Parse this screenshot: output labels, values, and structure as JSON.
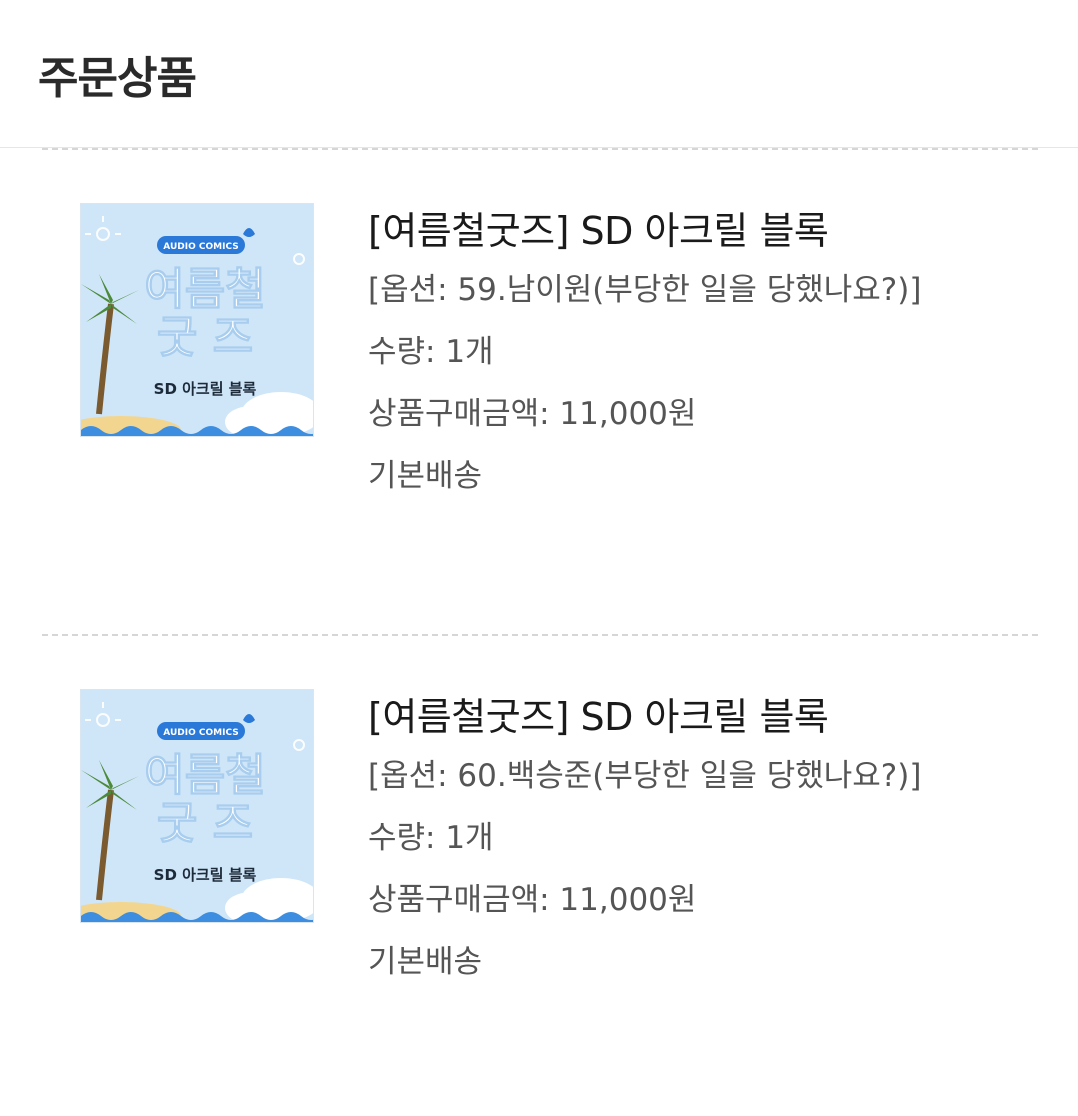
{
  "header": {
    "title": "주문상품"
  },
  "thumbnail": {
    "badge_text": "AUDIO COMICS",
    "headline_1": "여름철",
    "headline_2": "굿 즈",
    "subline": "SD 아크릴 블록"
  },
  "items": [
    {
      "title": "[여름철굿즈] SD 아크릴 블록",
      "option": "[옵션: 59.남이원(부당한 일을 당했나요?)]",
      "quantity": "수량: 1개",
      "price": "상품구매금액: 11,000원",
      "shipping": "기본배송"
    },
    {
      "title": "[여름철굿즈] SD 아크릴 블록",
      "option": "[옵션: 60.백승준(부당한 일을 당했나요?)]",
      "quantity": "수량: 1개",
      "price": "상품구매금액: 11,000원",
      "shipping": "기본배송"
    }
  ]
}
